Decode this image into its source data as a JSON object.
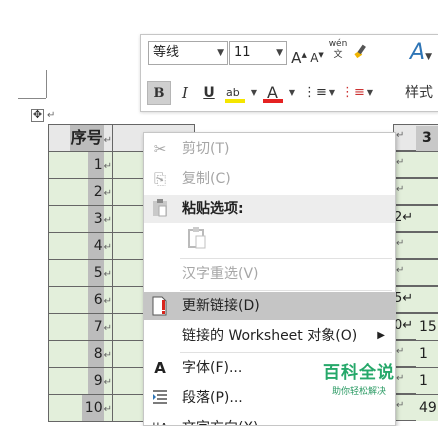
{
  "toolbar": {
    "font_name": "等线",
    "font_size": "11",
    "grow_font": "A",
    "shrink_font": "A",
    "phonetic": "wén\n文",
    "bold": "B",
    "italic": "I",
    "underline": "U",
    "highlight": "ab",
    "font_color": "A",
    "bullets": "⋮≡",
    "numbering": "⋮≡",
    "styles_label": "样式",
    "text_effects": "A",
    "colors": {
      "highlight": "#f5e600",
      "font_color": "#e52222"
    }
  },
  "table": {
    "header": "序号",
    "rows": [
      "1",
      "2",
      "3",
      "4",
      "5",
      "6",
      "7",
      "8",
      "9",
      "10"
    ],
    "right_col_header": "3",
    "right_col_values": [
      "",
      "",
      "",
      "2",
      "",
      "",
      "5",
      "0",
      "",
      ""
    ],
    "far_right_values": [
      "",
      "",
      "",
      "",
      "",
      "",
      "",
      "15",
      "1",
      "1",
      "49"
    ]
  },
  "context_menu": {
    "cut": "剪切(T)",
    "copy": "复制(C)",
    "paste_options": "粘贴选项:",
    "reconvert": "汉字重选(V)",
    "update_link": "更新链接(D)",
    "linked_object": "链接的 Worksheet 对象(O)",
    "font": "字体(F)...",
    "paragraph": "段落(P)...",
    "text_direction": "文字方向(X)...",
    "icons": {
      "cut": "scissors-icon",
      "copy": "copy-icon",
      "paste": "clipboard-icon",
      "update_link": "update-link-icon",
      "font": "font-icon",
      "paragraph": "paragraph-icon",
      "text_direction": "text-direction-icon"
    }
  },
  "watermark": {
    "title": "百科全说",
    "subtitle": "助你轻松解决"
  }
}
